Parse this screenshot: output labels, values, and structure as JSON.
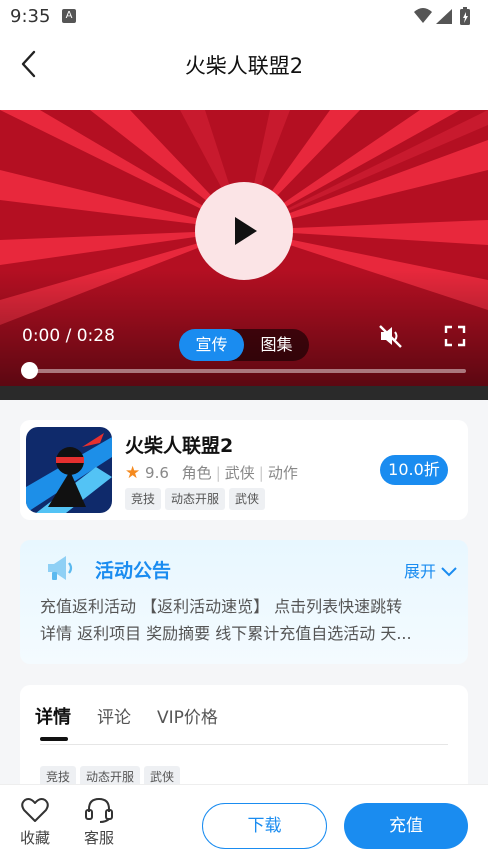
{
  "status_bar": {
    "time": "9:35",
    "notification_icon": "a-icon",
    "icons": [
      "wifi-icon",
      "signal-icon",
      "battery-icon"
    ]
  },
  "header": {
    "title": "火柴人联盟2",
    "back_icon": "chevron-left-icon"
  },
  "video": {
    "time_display": "0:00 / 0:28",
    "progress": 0.0,
    "tabs": [
      {
        "label": "宣传",
        "active": true
      },
      {
        "label": "图集",
        "active": false
      }
    ],
    "icons": [
      "play-icon",
      "mute-icon",
      "fullscreen-icon"
    ]
  },
  "game": {
    "name": "火柴人联盟2",
    "rating": "9.6",
    "categories": [
      "角色",
      "武侠",
      "动作"
    ],
    "tags": [
      "竞技",
      "动态开服",
      "武侠"
    ],
    "discount": "10.0折"
  },
  "notice": {
    "title": "活动公告",
    "expand_label": "展开",
    "text_line1": "充值返利活动 【返利活动速览】 点击列表快速跳转",
    "text_line2": "详情 返利项目 奖励摘要 线下累计充值自选活动 天..."
  },
  "details": {
    "tabs": [
      {
        "label": "详情",
        "active": true
      },
      {
        "label": "评论",
        "active": false
      },
      {
        "label": "VIP价格",
        "active": false
      }
    ],
    "tags": [
      "竞技",
      "动态开服",
      "武侠"
    ]
  },
  "bottom_bar": {
    "favorite_label": "收藏",
    "service_label": "客服",
    "download_label": "下载",
    "recharge_label": "充值"
  },
  "colors": {
    "accent": "#1a8cf0",
    "video_red": "#b40f22",
    "star": "#f58a1f"
  }
}
